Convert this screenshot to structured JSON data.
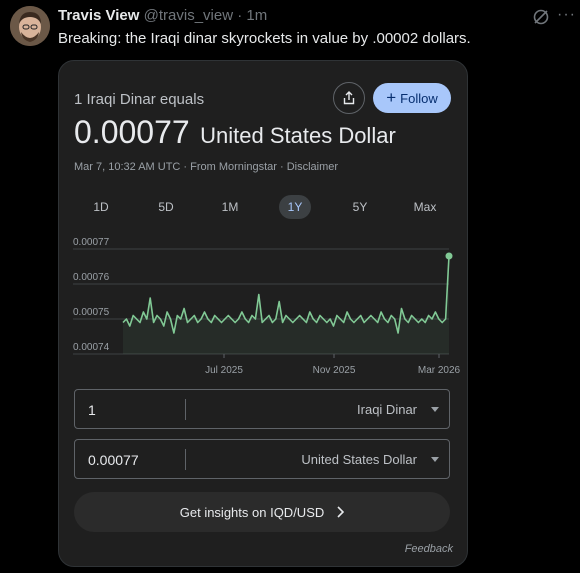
{
  "post": {
    "author_name": "Travis View",
    "author_handle": "@travis_view",
    "time": "· 1m",
    "text": "Breaking: the Iraqi dinar skyrockets in value by .00002 dollars."
  },
  "card": {
    "title": "1 Iraqi Dinar equals",
    "follow_label": "Follow",
    "value": "0.00077",
    "currency": "United States Dollar",
    "meta": "Mar 7, 10:32 AM UTC · From Morningstar · Disclaimer",
    "ranges": [
      "1D",
      "5D",
      "1M",
      "1Y",
      "5Y",
      "Max"
    ],
    "active_range": "1Y",
    "converter": {
      "from_value": "1",
      "from_currency": "Iraqi Dinar",
      "to_value": "0.00077",
      "to_currency": "United States Dollar"
    },
    "insights_label": "Get insights on IQD/USD",
    "feedback_label": "Feedback"
  },
  "colors": {
    "line": "#81c995",
    "accent": "#a8c7fa",
    "card_bg": "#1f1f1f"
  },
  "icons": [
    "avatar",
    "grok-icon",
    "more-icon",
    "share-icon",
    "chevron-right-icon"
  ],
  "chart_data": {
    "type": "line",
    "xlabel": "",
    "ylabel": "",
    "x_tick_labels": [
      "Jul 2025",
      "Nov 2025",
      "Mar 2026"
    ],
    "y_tick_labels": [
      "0.00077",
      "0.00076",
      "0.00075",
      "0.00074"
    ],
    "ylim": [
      0.00074,
      0.00077
    ],
    "grid": true,
    "series": [
      {
        "values": [
          0.000749,
          0.00075,
          0.000748,
          0.000751,
          0.00075,
          0.000749,
          0.000752,
          0.00075,
          0.000756,
          0.000749,
          0.000751,
          0.00075,
          0.000748,
          0.000752,
          0.00075,
          0.000746,
          0.000751,
          0.00075,
          0.000753,
          0.000749,
          0.00075,
          0.000751,
          0.000749,
          0.00075,
          0.000752,
          0.00075,
          0.000749,
          0.000751,
          0.00075,
          0.000749,
          0.00075,
          0.000751,
          0.00075,
          0.000749,
          0.00075,
          0.000752,
          0.00075,
          0.000749,
          0.000751,
          0.00075,
          0.000757,
          0.000749,
          0.00075,
          0.000751,
          0.000749,
          0.00075,
          0.000755,
          0.000749,
          0.000751,
          0.00075,
          0.000749,
          0.00075,
          0.000751,
          0.00075,
          0.000749,
          0.000752,
          0.00075,
          0.000749,
          0.000751,
          0.00075,
          0.000749,
          0.00075,
          0.000748,
          0.000751,
          0.00075,
          0.000749,
          0.000752,
          0.00075,
          0.000749,
          0.00075,
          0.000751,
          0.000749,
          0.00075,
          0.000751,
          0.00075,
          0.000749,
          0.000752,
          0.00075,
          0.000749,
          0.000751,
          0.00075,
          0.000746,
          0.000753,
          0.00075,
          0.000749,
          0.000751,
          0.00075,
          0.000749,
          0.00075,
          0.000749,
          0.000751,
          0.00075,
          0.000752,
          0.00075,
          0.000749,
          0.00075,
          0.000768
        ],
        "color": "#81c995"
      }
    ]
  }
}
